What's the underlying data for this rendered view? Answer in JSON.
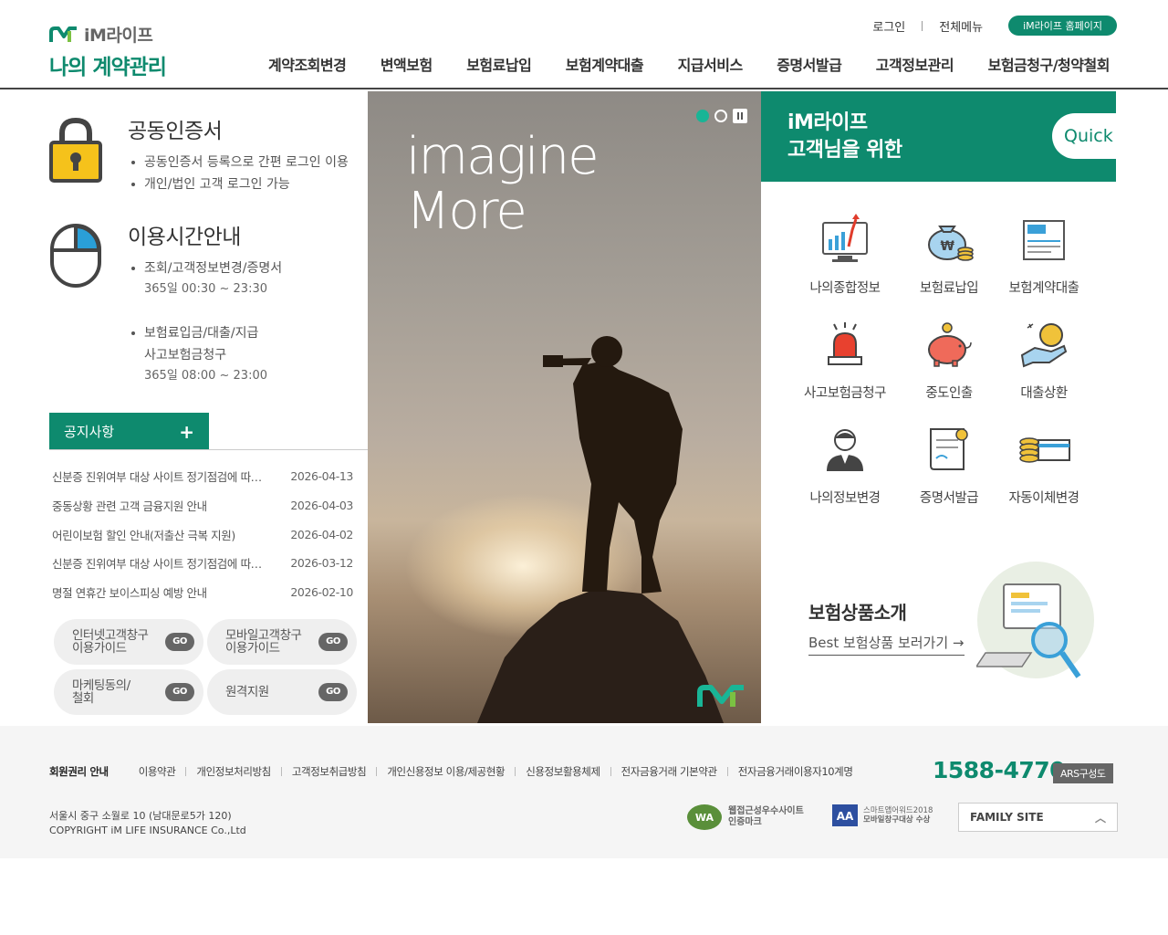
{
  "header": {
    "brand": "iM라이프",
    "site_title": "나의 계약관리",
    "util": {
      "login": "로그인",
      "all_menu": "전체메뉴",
      "homepage": "iM라이프 홈페이지"
    },
    "gnb": [
      "계약조회변경",
      "변액보험",
      "보험료납입",
      "보험계약대출",
      "지급서비스",
      "증명서발급",
      "고객정보관리",
      "보험금청구/청약철회"
    ]
  },
  "left": {
    "cert": {
      "title": "공동인증서",
      "items": [
        "공동인증서 등록으로 간편 로그인 이용",
        "개인/법인 고객 로그인 가능"
      ]
    },
    "hours": {
      "title": "이용시간안내",
      "item1": {
        "label": "조회/고객정보변경/증명서",
        "time": "365일  00:30 ~ 23:30"
      },
      "item2": {
        "label1": "보험료입금/대출/지급",
        "label2": "사고보험금청구",
        "time": "365일  08:00 ~ 23:00"
      }
    },
    "notice": {
      "tab_label": "공지사항",
      "plus": "+",
      "items": [
        {
          "title": "신분증 진위여부 대상 사이트 정기점검에 따른 서비스 일시 중단 안내",
          "date": "2026-04-13"
        },
        {
          "title": "중동상황 관련 고객 금융지원 안내",
          "date": "2026-04-03"
        },
        {
          "title": "어린이보험 할인 안내(저출산 극복 지원)",
          "date": "2026-04-02"
        },
        {
          "title": "신분증 진위여부 대상 사이트 정기점검에 따른 서비스 일시 중단 안내",
          "date": "2026-03-12"
        },
        {
          "title": "명절 연휴간 보이스피싱 예방 안내",
          "date": "2026-02-10"
        }
      ]
    },
    "guides": [
      {
        "line1": "인터넷고객창구",
        "line2": "이용가이드",
        "go": "GO"
      },
      {
        "line1": "모바일고객창구",
        "line2": "이용가이드",
        "go": "GO"
      },
      {
        "line1": "마케팅동의/",
        "line2": "철회",
        "go": "GO"
      },
      {
        "line1": "원격지원",
        "line2": "",
        "go": "GO"
      }
    ]
  },
  "banner": {
    "line1": "imagine",
    "line2": "More"
  },
  "quick": {
    "title1": "iM라이프",
    "title2": "고객님을 위한",
    "button": "Quick",
    "items": [
      {
        "label": "나의종합정보",
        "icon": "monitor-chart-icon"
      },
      {
        "label": "보험료납입",
        "icon": "money-bag-icon"
      },
      {
        "label": "보험계약대출",
        "icon": "document-icon"
      },
      {
        "label": "사고보험금청구",
        "icon": "siren-icon"
      },
      {
        "label": "중도인출",
        "icon": "piggy-bank-icon"
      },
      {
        "label": "대출상환",
        "icon": "hand-coin-icon"
      },
      {
        "label": "나의정보변경",
        "icon": "person-icon"
      },
      {
        "label": "증명서발급",
        "icon": "certificate-icon"
      },
      {
        "label": "자동이체변경",
        "icon": "coin-card-icon"
      }
    ]
  },
  "promo": {
    "title": "보험상품소개",
    "link": "Best 보험상품 보러가기 →"
  },
  "footer": {
    "links": [
      "회원권리 안내",
      "이용약관",
      "개인정보처리방침",
      "고객정보취급방침",
      "개인신용정보 이용/제공현황",
      "신용정보활용체제",
      "전자금융거래 기본약관",
      "전자금융거래이용자10계명"
    ],
    "phone": "1588-4770",
    "ars": "ARS구성도",
    "address": "서울시 중구 소월로 10 (남대문로5가 120)",
    "copyright": "COPYRIGHT iM LIFE INSURANCE Co.,Ltd",
    "cert1_line1": "웹접근성우수사이트",
    "cert1_line2": "인증마크",
    "cert2_line1": "스마트앱어워드2018",
    "cert2_line2": "모바일창구대상 수상",
    "family_site": "FAMILY SITE"
  },
  "colors": {
    "brand": "#0e8a6e",
    "accent": "#19b596"
  }
}
